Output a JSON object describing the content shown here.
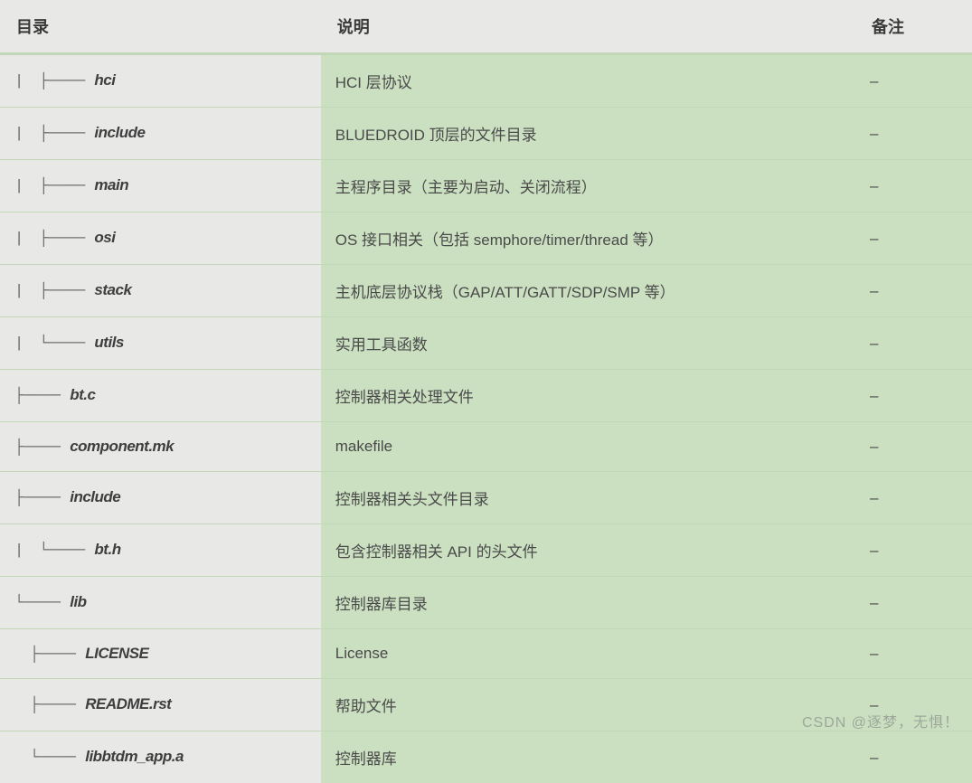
{
  "headers": {
    "col1": "目录",
    "col2": "说明",
    "col3": "备注"
  },
  "rows": [
    {
      "prefix": "| ├──── ",
      "name": "hci",
      "desc": "HCI 层协议",
      "note": "–"
    },
    {
      "prefix": "| ├──── ",
      "name": "include",
      "desc": "BLUEDROID 顶层的文件目录",
      "note": "–"
    },
    {
      "prefix": "| ├──── ",
      "name": "main",
      "desc": "主程序目录（主要为启动、关闭流程）",
      "note": "–"
    },
    {
      "prefix": "| ├──── ",
      "name": "osi",
      "desc": "OS 接口相关（包括 semphore/timer/thread 等）",
      "note": "–"
    },
    {
      "prefix": "| ├──── ",
      "name": "stack",
      "desc": "主机底层协议栈（GAP/ATT/GATT/SDP/SMP 等）",
      "note": "–"
    },
    {
      "prefix": "| └──── ",
      "name": "utils",
      "desc": "实用工具函数",
      "note": "–"
    },
    {
      "prefix": "├──── ",
      "name": "bt.c",
      "desc": "控制器相关处理文件",
      "note": "–"
    },
    {
      "prefix": "├──── ",
      "name": "component.mk",
      "desc": "makefile",
      "note": "–"
    },
    {
      "prefix": "├──── ",
      "name": "include",
      "desc": "控制器相关头文件目录",
      "note": "–"
    },
    {
      "prefix": "| └──── ",
      "name": "bt.h",
      "desc": "包含控制器相关 API 的头文件",
      "note": "–"
    },
    {
      "prefix": "└──── ",
      "name": "lib",
      "desc": "控制器库目录",
      "note": "–"
    },
    {
      "prefix": " ├──── ",
      "name": "LICENSE",
      "desc": "License",
      "note": "–"
    },
    {
      "prefix": " ├──── ",
      "name": "README.rst",
      "desc": "帮助文件",
      "note": "–"
    },
    {
      "prefix": " └──── ",
      "name": "libbtdm_app.a",
      "desc": "控制器库",
      "note": "–"
    }
  ],
  "watermark": "CSDN @逐梦，无惧！"
}
